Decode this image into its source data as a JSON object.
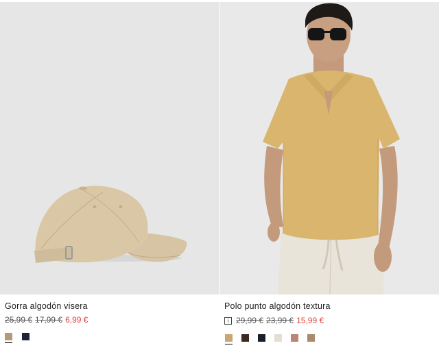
{
  "products": [
    {
      "name": "Gorra algodón visera",
      "prices": {
        "original": "25,99 €",
        "previous": "17,99 €",
        "sale": "6,99 €"
      },
      "swatch_colors": [
        "#b49a78",
        "#1c2438"
      ],
      "selected_swatch": 0
    },
    {
      "name": "Polo punto algodón textura",
      "info_icon": "i",
      "prices": {
        "original": "29,99 €",
        "previous": "23,99 €",
        "sale": "15,99 €"
      },
      "swatch_colors": [
        "#c8a770",
        "#3b2a22",
        "#1b1f2a",
        "#e3ded2",
        "#b98672",
        "#a98a6c"
      ],
      "selected_swatch": 0
    }
  ],
  "colors": {
    "sale_price": "#e5413e",
    "photo_background": "#e6e6e6"
  }
}
